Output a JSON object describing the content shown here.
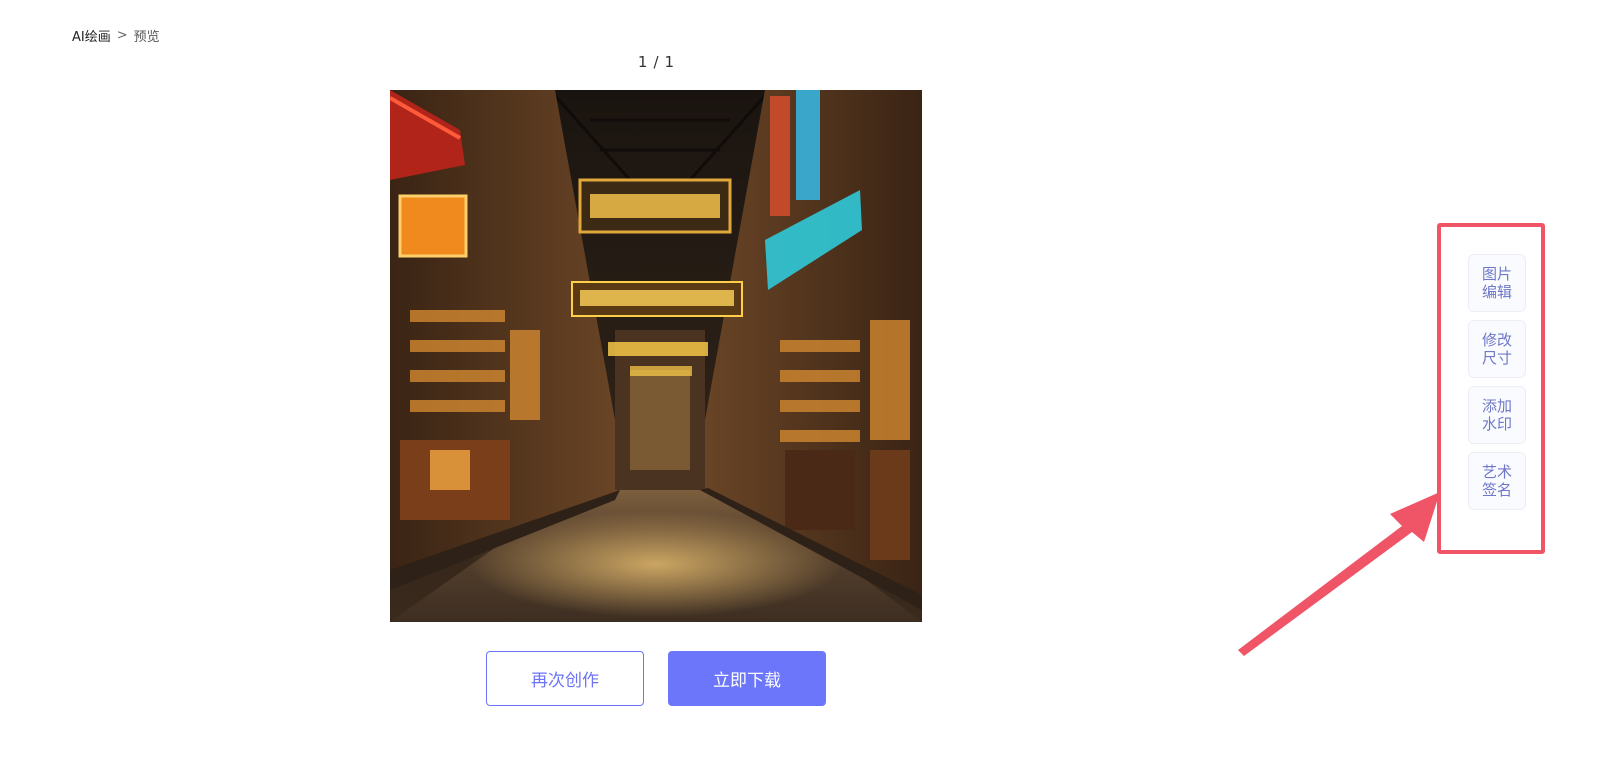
{
  "breadcrumb": {
    "root": "AI绘画",
    "separator": ">",
    "current": "预览"
  },
  "pager": {
    "current": "1",
    "separator": "/",
    "total": "1"
  },
  "actions": {
    "recreate_label": "再次创作",
    "download_label": "立即下载"
  },
  "side_tools": [
    {
      "line1": "图片",
      "line2": "编辑"
    },
    {
      "line1": "修改",
      "line2": "尺寸"
    },
    {
      "line1": "添加",
      "line2": "水印"
    },
    {
      "line1": "艺术",
      "line2": "签名"
    }
  ],
  "colors": {
    "accent": "#6b76fb",
    "annotation": "#ef5566",
    "tool_text": "#6f78c8"
  },
  "icons": {
    "annotation_arrow": "arrow-icon"
  }
}
